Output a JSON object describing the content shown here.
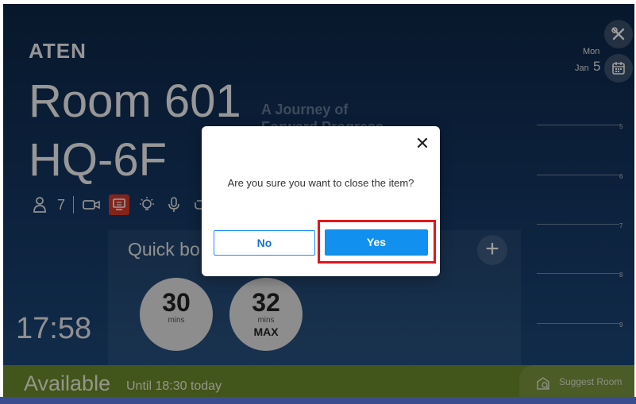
{
  "brand": {
    "logo_text": "ATEN"
  },
  "room": {
    "name_line1": "Room 601",
    "name_line2": "HQ-6F"
  },
  "background_event": {
    "title_line1": "A Journey of",
    "title_line2": "Forward Progress"
  },
  "amenities": {
    "capacity": "7",
    "icons": [
      "person-icon",
      "camera-icon",
      "display-icon",
      "light-icon",
      "microphone-icon",
      "loop-icon"
    ],
    "active_icon": "display-icon"
  },
  "quick_book": {
    "title": "Quick bo",
    "add_label": "+"
  },
  "durations": [
    {
      "value": "30",
      "unit": "mins",
      "extra": ""
    },
    {
      "value": "32",
      "unit": "mins",
      "extra": "MAX"
    }
  ],
  "clock": "17:58",
  "date": {
    "weekday": "Mon",
    "month": "Jan",
    "day": "5"
  },
  "timeline": {
    "hours": [
      "5",
      "6",
      "7",
      "8",
      "9"
    ]
  },
  "availability": {
    "status": "Available",
    "detail": "Until 18:30 today"
  },
  "suggest": {
    "label": "Suggest Room"
  },
  "dialog": {
    "message": "Are you sure you want to close the item?",
    "close_glyph": "✕",
    "no_label": "No",
    "yes_label": "Yes"
  },
  "colors": {
    "accent_blue": "#1290ef",
    "available_green": "#6b8a2a",
    "highlight_red": "#e0161c",
    "active_icon_red": "#d33a2c"
  }
}
